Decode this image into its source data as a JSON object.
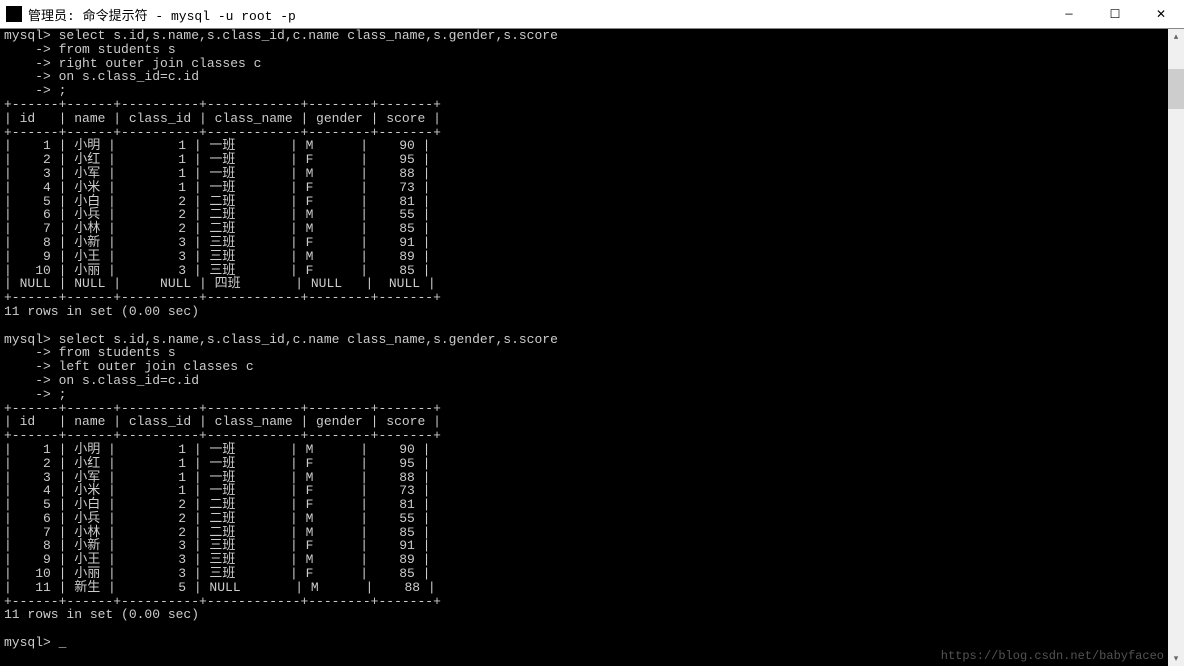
{
  "window": {
    "title": "管理员: 命令提示符 - mysql  -u root -p"
  },
  "controls": {
    "minimize": "—",
    "maximize": "☐",
    "close": "✕"
  },
  "prompt": "mysql>",
  "cont_prompt": "    ->",
  "query1": {
    "select": "select s.id,s.name,s.class_id,c.name class_name,s.gender,s.score",
    "from": "from students s",
    "join": "right outer join classes c",
    "on": "on s.class_id=c.id",
    "term": ";"
  },
  "query2": {
    "select": "select s.id,s.name,s.class_id,c.name class_name,s.gender,s.score",
    "from": "from students s",
    "join": "left outer join classes c",
    "on": "on s.class_id=c.id",
    "term": ";"
  },
  "headers": [
    "id",
    "name",
    "class_id",
    "class_name",
    "gender",
    "score"
  ],
  "sep": "+------+------+----------+------------+--------+-------+",
  "rows1": [
    {
      "id": "1",
      "name": "小明",
      "class_id": "1",
      "class_name": "一班",
      "gender": "M",
      "score": "90"
    },
    {
      "id": "2",
      "name": "小红",
      "class_id": "1",
      "class_name": "一班",
      "gender": "F",
      "score": "95"
    },
    {
      "id": "3",
      "name": "小军",
      "class_id": "1",
      "class_name": "一班",
      "gender": "M",
      "score": "88"
    },
    {
      "id": "4",
      "name": "小米",
      "class_id": "1",
      "class_name": "一班",
      "gender": "F",
      "score": "73"
    },
    {
      "id": "5",
      "name": "小白",
      "class_id": "2",
      "class_name": "二班",
      "gender": "F",
      "score": "81"
    },
    {
      "id": "6",
      "name": "小兵",
      "class_id": "2",
      "class_name": "二班",
      "gender": "M",
      "score": "55"
    },
    {
      "id": "7",
      "name": "小林",
      "class_id": "2",
      "class_name": "二班",
      "gender": "M",
      "score": "85"
    },
    {
      "id": "8",
      "name": "小新",
      "class_id": "3",
      "class_name": "三班",
      "gender": "F",
      "score": "91"
    },
    {
      "id": "9",
      "name": "小王",
      "class_id": "3",
      "class_name": "三班",
      "gender": "M",
      "score": "89"
    },
    {
      "id": "10",
      "name": "小丽",
      "class_id": "3",
      "class_name": "三班",
      "gender": "F",
      "score": "85"
    },
    {
      "id": "NULL",
      "name": "NULL",
      "class_id": "NULL",
      "class_name": "四班",
      "gender": "NULL",
      "score": "NULL"
    }
  ],
  "rows2": [
    {
      "id": "1",
      "name": "小明",
      "class_id": "1",
      "class_name": "一班",
      "gender": "M",
      "score": "90"
    },
    {
      "id": "2",
      "name": "小红",
      "class_id": "1",
      "class_name": "一班",
      "gender": "F",
      "score": "95"
    },
    {
      "id": "3",
      "name": "小军",
      "class_id": "1",
      "class_name": "一班",
      "gender": "M",
      "score": "88"
    },
    {
      "id": "4",
      "name": "小米",
      "class_id": "1",
      "class_name": "一班",
      "gender": "F",
      "score": "73"
    },
    {
      "id": "5",
      "name": "小白",
      "class_id": "2",
      "class_name": "二班",
      "gender": "F",
      "score": "81"
    },
    {
      "id": "6",
      "name": "小兵",
      "class_id": "2",
      "class_name": "二班",
      "gender": "M",
      "score": "55"
    },
    {
      "id": "7",
      "name": "小林",
      "class_id": "2",
      "class_name": "二班",
      "gender": "M",
      "score": "85"
    },
    {
      "id": "8",
      "name": "小新",
      "class_id": "3",
      "class_name": "三班",
      "gender": "F",
      "score": "91"
    },
    {
      "id": "9",
      "name": "小王",
      "class_id": "3",
      "class_name": "三班",
      "gender": "M",
      "score": "89"
    },
    {
      "id": "10",
      "name": "小丽",
      "class_id": "3",
      "class_name": "三班",
      "gender": "F",
      "score": "85"
    },
    {
      "id": "11",
      "name": "新生",
      "class_id": "5",
      "class_name": "NULL",
      "gender": "M",
      "score": "88"
    }
  ],
  "result_msg": "11 rows in set (0.00 sec)",
  "cursor": "_",
  "watermark": "https://blog.csdn.net/babyfaceo"
}
